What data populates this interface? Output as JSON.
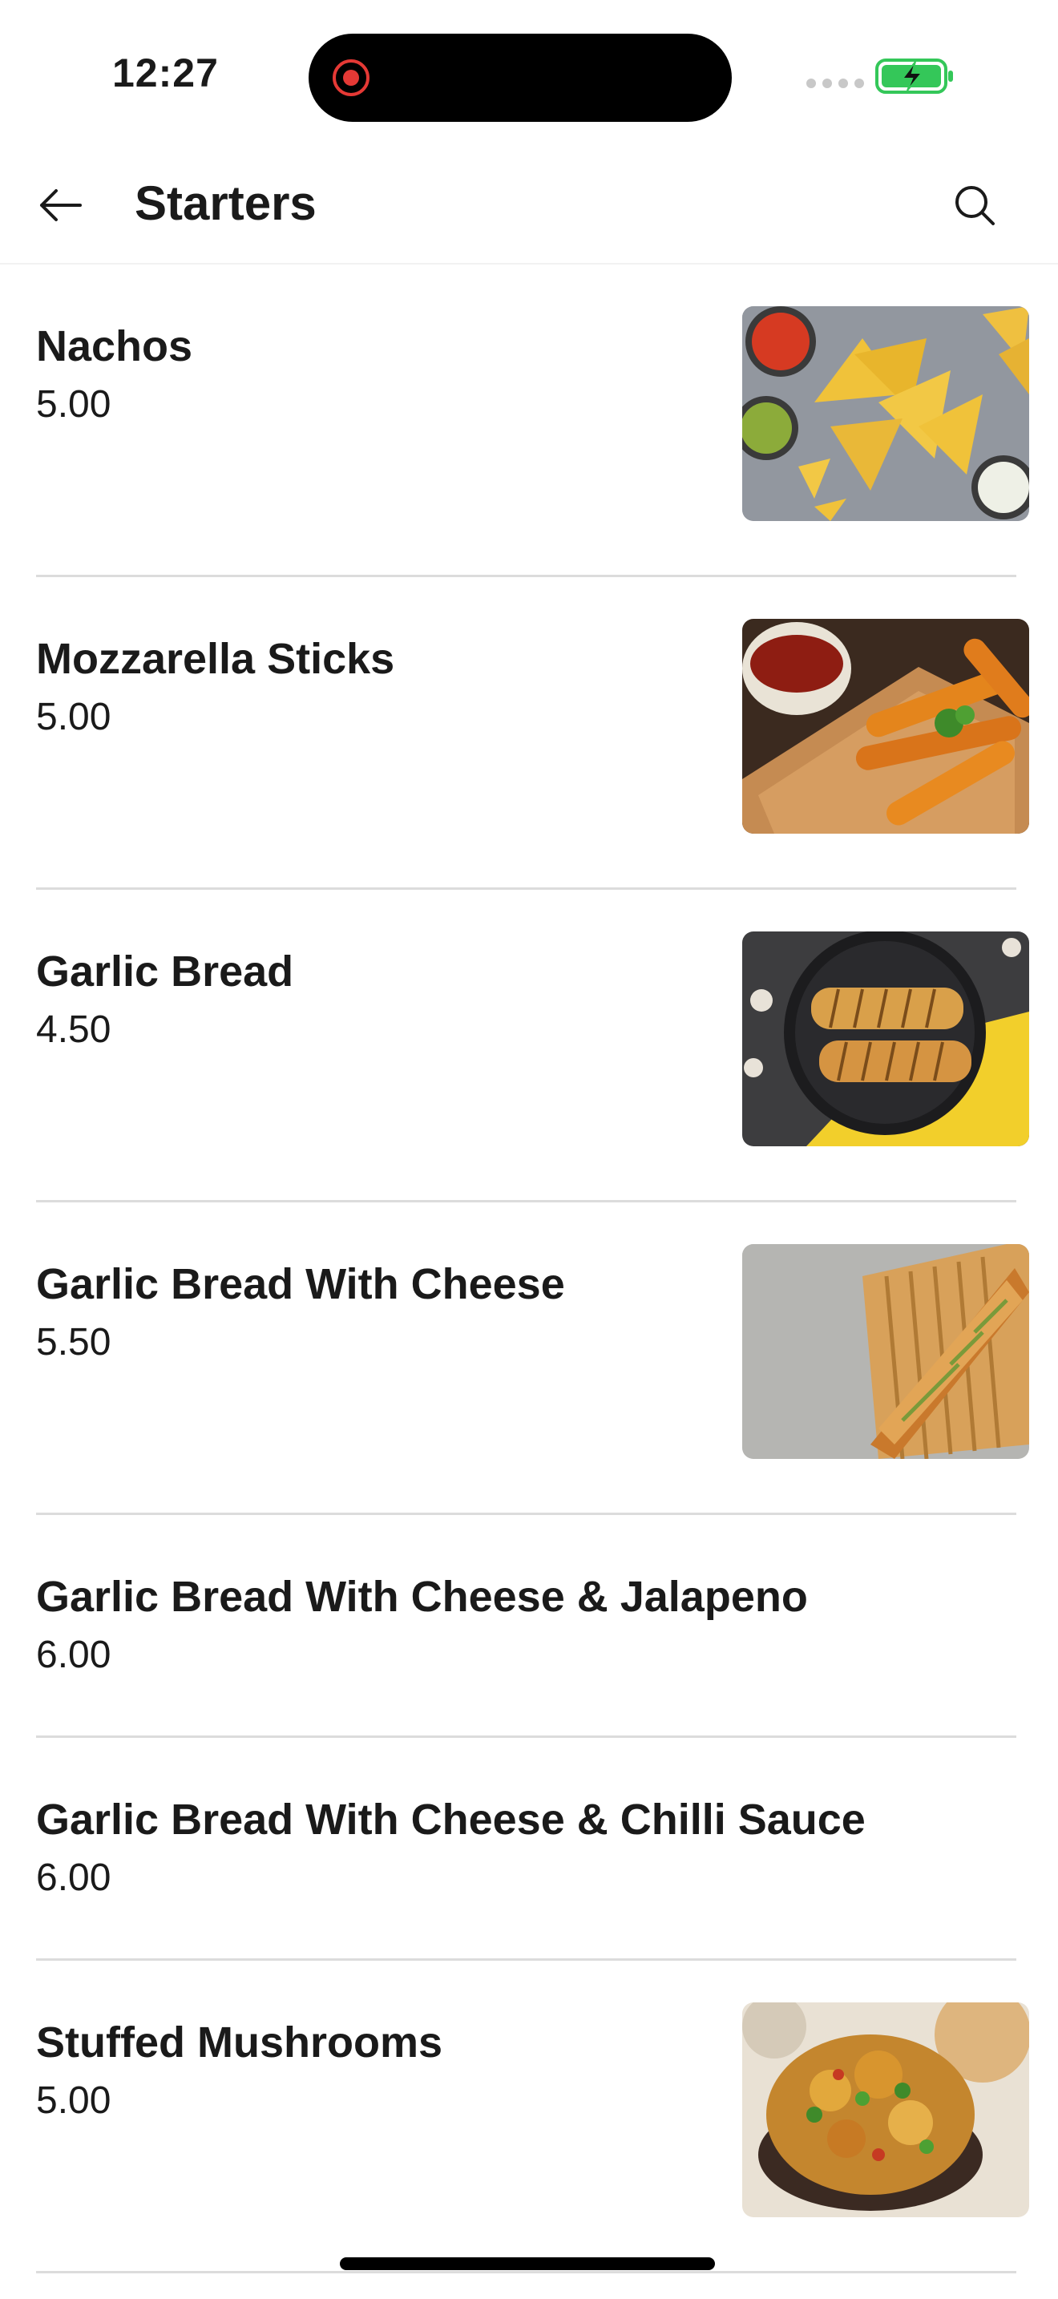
{
  "status_bar": {
    "time": "12:27",
    "recording_icon": "screen-recording-icon",
    "signal_icon": "cellular-signal-icon",
    "battery_icon": "battery-charging-icon",
    "battery_color": "#34c759"
  },
  "header": {
    "back_icon": "arrow-left-icon",
    "title": "Starters",
    "search_icon": "search-icon"
  },
  "menu": {
    "items": [
      {
        "name": "Nachos",
        "price": "5.00",
        "image": "nachos-photo"
      },
      {
        "name": "Mozzarella Sticks",
        "price": "5.00",
        "image": "mozzarella-sticks-photo"
      },
      {
        "name": "Garlic Bread",
        "price": "4.50",
        "image": "garlic-bread-photo"
      },
      {
        "name": "Garlic Bread With Cheese",
        "price": "5.50",
        "image": "garlic-bread-cheese-photo"
      },
      {
        "name": "Garlic Bread With Cheese & Jalapeno",
        "price": "6.00"
      },
      {
        "name": "Garlic Bread With Cheese & Chilli Sauce",
        "price": "6.00"
      },
      {
        "name": "Stuffed Mushrooms",
        "price": "5.00",
        "image": "stuffed-mushrooms-photo"
      }
    ]
  }
}
